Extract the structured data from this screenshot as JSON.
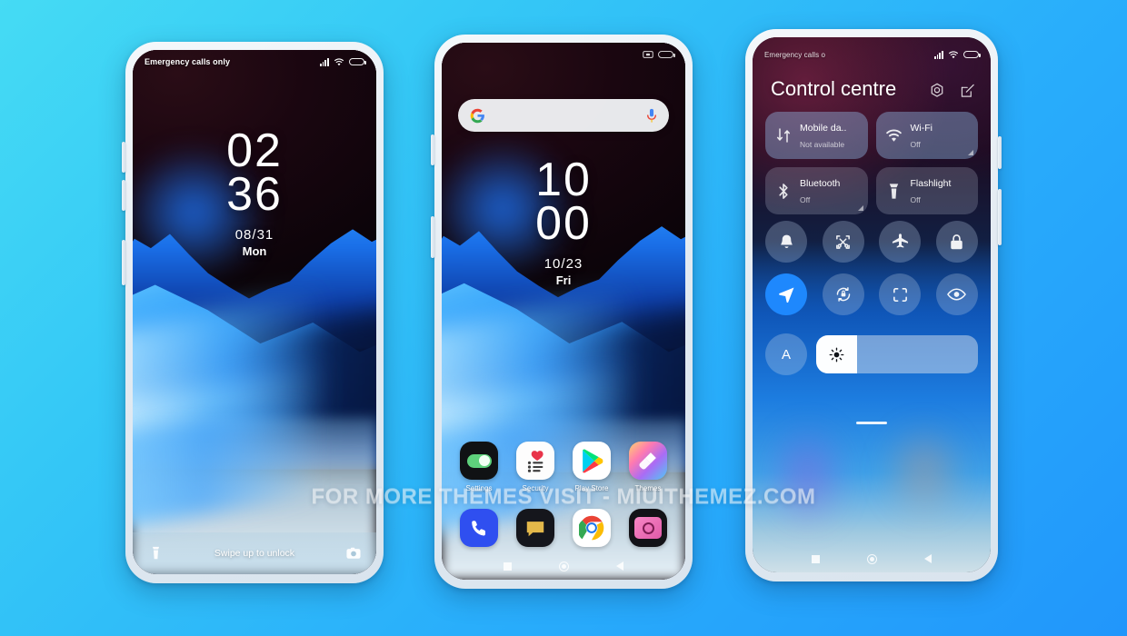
{
  "background": {
    "from": "#45dbf4",
    "to": "#2196fb"
  },
  "watermark": {
    "text": "FOR MORE THEMES VISIT - MIUITHEMEZ.COM"
  },
  "phones": {
    "lockscreen": {
      "status": {
        "carrier": "Emergency calls only",
        "signal_icon": "signal-bars-icon",
        "wifi_icon": "wifi-icon",
        "battery_icon": "battery-icon"
      },
      "clock": {
        "hours": "02",
        "minutes": "36",
        "date": "08/31",
        "weekday": "Mon"
      },
      "bottom": {
        "flashlight_icon": "flashlight-icon",
        "hint": "Swipe up to unlock",
        "camera_icon": "camera-icon"
      }
    },
    "homescreen": {
      "status": {
        "screenshot_icon": "screenshot-icon",
        "battery_icon": "battery-icon"
      },
      "search": {
        "google_icon": "google-g-icon",
        "placeholder": "",
        "mic_icon": "microphone-icon"
      },
      "clock": {
        "hours": "10",
        "minutes": "00",
        "date": "10/23",
        "weekday": "Fri"
      },
      "apps": [
        {
          "label": "Settings",
          "icon": "settings-toggle-icon"
        },
        {
          "label": "Security",
          "icon": "security-heart-icon"
        },
        {
          "label": "Play Store",
          "icon": "play-store-icon"
        },
        {
          "label": "Themes",
          "icon": "themes-brush-icon"
        }
      ],
      "dock": [
        {
          "label": "Phone",
          "icon": "phone-icon"
        },
        {
          "label": "Messages",
          "icon": "messages-icon"
        },
        {
          "label": "Chrome",
          "icon": "chrome-icon"
        },
        {
          "label": "Camera",
          "icon": "camera-app-icon"
        }
      ],
      "nav": {
        "recents_icon": "recents-square-icon",
        "home_icon": "home-circle-icon",
        "back_icon": "back-triangle-icon"
      }
    },
    "controlcentre": {
      "status": {
        "carrier": "Emergency calls o",
        "signal_icon": "signal-bars-icon",
        "wifi_icon": "wifi-icon",
        "battery_icon": "battery-icon"
      },
      "title": "Control centre",
      "actions": [
        {
          "name": "settings-gear-icon"
        },
        {
          "name": "edit-icon"
        }
      ],
      "tiles": [
        {
          "name": "Mobile da..",
          "status": "Not available",
          "icon": "mobile-data-icon",
          "state": "on",
          "expandable": false
        },
        {
          "name": "Wi-Fi",
          "status": "Off",
          "icon": "wifi-tile-icon",
          "state": "on",
          "expandable": true
        },
        {
          "name": "Bluetooth",
          "status": "Off",
          "icon": "bluetooth-icon",
          "state": "off",
          "expandable": true
        },
        {
          "name": "Flashlight",
          "status": "Off",
          "icon": "flashlight-tile-icon",
          "state": "off",
          "expandable": false
        }
      ],
      "toggles_row1": [
        {
          "icon": "silent-bell-icon",
          "active": false
        },
        {
          "icon": "screenshot-scissors-icon",
          "active": false
        },
        {
          "icon": "airplane-mode-icon",
          "active": false
        },
        {
          "icon": "lock-icon",
          "active": false
        }
      ],
      "toggles_row2": [
        {
          "icon": "location-icon",
          "active": true
        },
        {
          "icon": "auto-rotate-icon",
          "active": false
        },
        {
          "icon": "scanner-icon",
          "active": false
        },
        {
          "icon": "eye-reading-mode-icon",
          "active": false
        }
      ],
      "brightness": {
        "auto_label": "A",
        "level_percent": 25,
        "sun_icon": "brightness-sun-icon",
        "handle": "drag-handle"
      },
      "nav": {
        "recents_icon": "recents-square-icon",
        "home_icon": "home-circle-icon",
        "back_icon": "back-triangle-icon"
      }
    }
  }
}
